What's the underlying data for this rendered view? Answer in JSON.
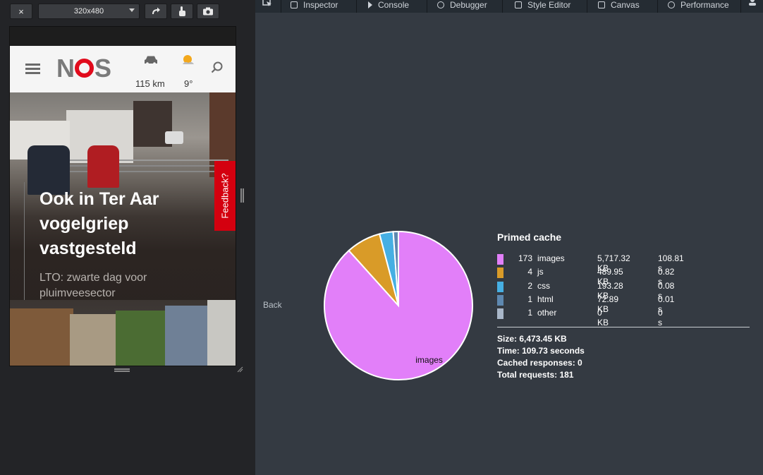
{
  "rdm_toolbar": {
    "close_label": "×",
    "preset": "320x480",
    "rotate_icon": "rotate-icon",
    "touch_icon": "touch-icon",
    "screenshot_icon": "camera-icon"
  },
  "site": {
    "logo_text": [
      "N",
      "S"
    ],
    "traffic_value": "115 km",
    "weather_value": "9°",
    "hero_title": "Ook in Ter Aar vogelgriep vastgesteld",
    "hero_subtitle": "LTO: zwarte dag voor pluimveesector",
    "feedback_label": "Feedback?"
  },
  "devtools": {
    "tabs": [
      {
        "label": "Inspector",
        "icon": "inspector-icon"
      },
      {
        "label": "Console",
        "icon": "console-icon"
      },
      {
        "label": "Debugger",
        "icon": "debugger-icon"
      },
      {
        "label": "Style Editor",
        "icon": "style-editor-icon"
      },
      {
        "label": "Canvas",
        "icon": "canvas-icon"
      },
      {
        "label": "Performance",
        "icon": "performance-icon"
      }
    ]
  },
  "stats": {
    "back_label": "Back",
    "title": "Primed cache",
    "rows": [
      {
        "count": "173",
        "type": "images",
        "size": "5,717.32 KB",
        "time": "108.81 s",
        "color": "#e27ff9"
      },
      {
        "count": "4",
        "type": "js",
        "size": "489.95 KB",
        "time": "0.82 s",
        "color": "#d99b28"
      },
      {
        "count": "2",
        "type": "css",
        "size": "193.28 KB",
        "time": "0.08 s",
        "color": "#46afe3"
      },
      {
        "count": "1",
        "type": "html",
        "size": "72.89 KB",
        "time": "0.01 s",
        "color": "#5e88b0"
      },
      {
        "count": "1",
        "type": "other",
        "size": "0 KB",
        "time": "0 s",
        "color": "#a9b7c9"
      }
    ],
    "summary_size": "Size: 6,473.45 KB",
    "summary_time": "Time: 109.73 seconds",
    "summary_cached": "Cached responses: 0",
    "summary_total": "Total requests: 181"
  },
  "chart_data": {
    "type": "pie",
    "categories": [
      "images",
      "js",
      "css",
      "html",
      "other"
    ],
    "values": [
      5717.32,
      489.95,
      193.28,
      72.89,
      0
    ],
    "colors": [
      "#e27ff9",
      "#d99b28",
      "#46afe3",
      "#5e88b0",
      "#a9b7c9"
    ],
    "slice_labels": [
      "images"
    ]
  }
}
